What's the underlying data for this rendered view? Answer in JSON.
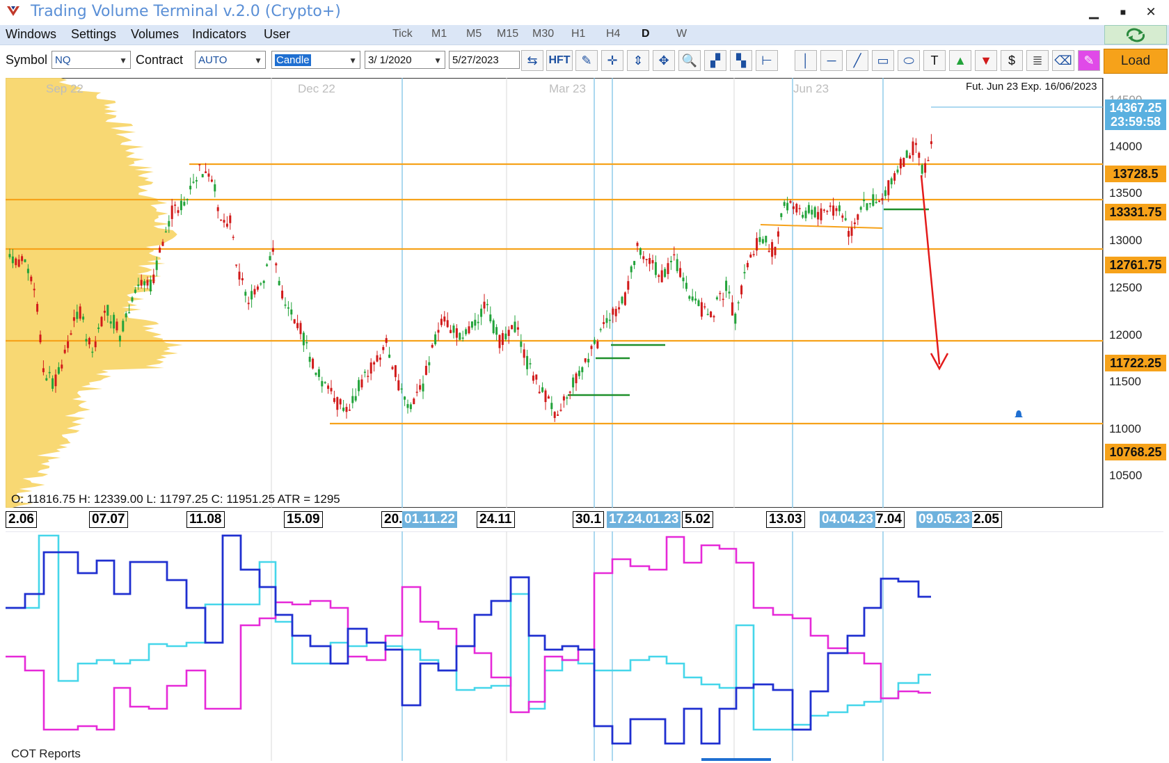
{
  "window": {
    "title": "Trading Volume Terminal v.2.0 (Crypto+)",
    "minimize": "▁",
    "maximize": "■",
    "close": "✕"
  },
  "menu": {
    "items": [
      "Windows",
      "Settings",
      "Volumes",
      "Indicators",
      "User"
    ],
    "timeframes": [
      "Tick",
      "M1",
      "M5",
      "M15",
      "M30",
      "H1",
      "H4",
      "D",
      "W"
    ],
    "active_timeframe": "D"
  },
  "toolbar": {
    "symbol_label": "Symbol",
    "symbol_value": "NQ",
    "contract_label": "Contract",
    "contract_value": "AUTO",
    "chart_type": "Candle",
    "date_from": "3/ 1/2020",
    "date_to": "5/27/2023",
    "hft_label": "HFT",
    "text_tool": "T",
    "dollar_tool": "$",
    "load_label": "Load"
  },
  "chart": {
    "expiry_text": "Fut. Jun 23 Exp. 16/06/2023",
    "period_labels": [
      "Sep 22",
      "Dec 22",
      "Mar 23",
      "Jun 23"
    ],
    "price_axis": [
      "14500",
      "14000",
      "13500",
      "13000",
      "12500",
      "12000",
      "11500",
      "11000",
      "10500"
    ],
    "last_price": "14367.25",
    "countdown": "23:59:58",
    "levels": [
      "13728.5",
      "13331.75",
      "12761.75",
      "11722.25",
      "10768.25"
    ],
    "level_color": "#f6a21a",
    "ohlc_text": "O: 11816.75   H: 12339.00   L: 11797.25   C: 11951.25   ATR = 1295",
    "date_axis": [
      "2.06",
      "07.07",
      "11.08",
      "15.09",
      "20.",
      "24.11",
      "30.1",
      "5.02",
      "13.03",
      "7.04",
      "2.05"
    ],
    "highlighted_dates": [
      "01.11.22",
      "17.24.01.23",
      "04.04.23",
      "09.05.23"
    ],
    "highlight_color": "#6fb2dd",
    "colors": {
      "bull": "#22a33a",
      "bear": "#d11a1a",
      "profile": "#f8d66b",
      "vline": "#7ec3e6"
    }
  },
  "cot": {
    "label": "COT Reports",
    "colors": {
      "dark_blue": "#1f2fd0",
      "cyan": "#45d6ea",
      "magenta": "#e629d8"
    }
  }
}
